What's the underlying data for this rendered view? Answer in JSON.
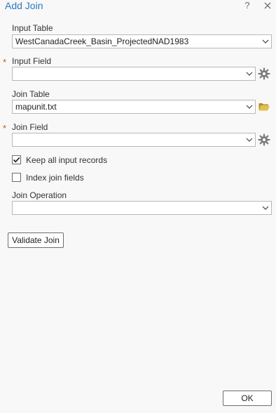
{
  "dialog": {
    "title": "Add Join",
    "help_label": "?"
  },
  "form": {
    "input_table": {
      "label": "Input Table",
      "value": "WestCanadaCreek_Basin_ProjectedNAD1983"
    },
    "input_field": {
      "label": "Input Field",
      "value": "",
      "required_marker": "*"
    },
    "join_table": {
      "label": "Join Table",
      "value": "mapunit.txt"
    },
    "join_field": {
      "label": "Join Field",
      "value": "",
      "required_marker": "*"
    },
    "keep_all": {
      "label": "Keep all input records",
      "checked": true
    },
    "index_join": {
      "label": "Index join fields",
      "checked": false
    },
    "join_operation": {
      "label": "Join Operation",
      "value": ""
    }
  },
  "buttons": {
    "validate_label": "Validate Join",
    "ok_label": "OK"
  },
  "icons": {
    "gear": "gear-icon",
    "folder": "folder-open-icon",
    "chevron": "chevron-down-icon",
    "close": "close-icon"
  },
  "colors": {
    "title": "#2a7bbf",
    "required": "#d35400",
    "folder": "#c9a227",
    "gear": "#7a7a7a"
  }
}
